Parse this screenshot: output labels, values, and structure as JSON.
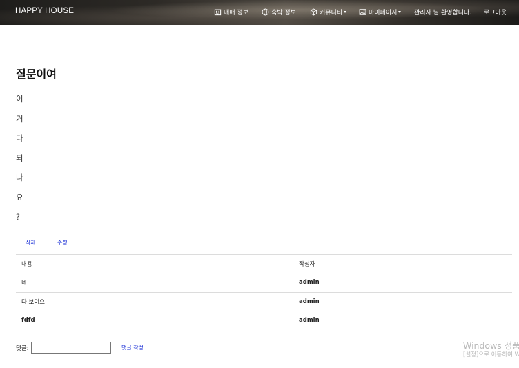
{
  "navbar": {
    "brand": "HAPPY HOUSE",
    "items": [
      {
        "label": "매매 정보",
        "icon": "building-icon"
      },
      {
        "label": "숙박 정보",
        "icon": "globe-icon"
      },
      {
        "label": "커뮤니티",
        "icon": "box-icon"
      },
      {
        "label": "마이페이지",
        "icon": "image-icon"
      }
    ],
    "welcome": "관리자 님 환영합니다.",
    "logout": "로그아웃"
  },
  "post": {
    "title": "질문이여",
    "lines": [
      "이",
      "거",
      "다",
      "되",
      "나",
      "요",
      "?"
    ]
  },
  "actions": {
    "delete": "삭제",
    "edit": "수정"
  },
  "comments": {
    "headers": {
      "content": "내용",
      "author": "작성자"
    },
    "rows": [
      {
        "content": "네",
        "author": "admin"
      },
      {
        "content": "다 보여요",
        "author": "admin"
      },
      {
        "content": "fdfd",
        "author": "admin"
      }
    ]
  },
  "comment_form": {
    "label": "댓글:",
    "value": "",
    "submit": "댓글 작성"
  },
  "watermark": {
    "line1": "Windows 정품 인증",
    "line2": "[설정]으로 이동하여 Windows를 정품 인증합니다."
  }
}
